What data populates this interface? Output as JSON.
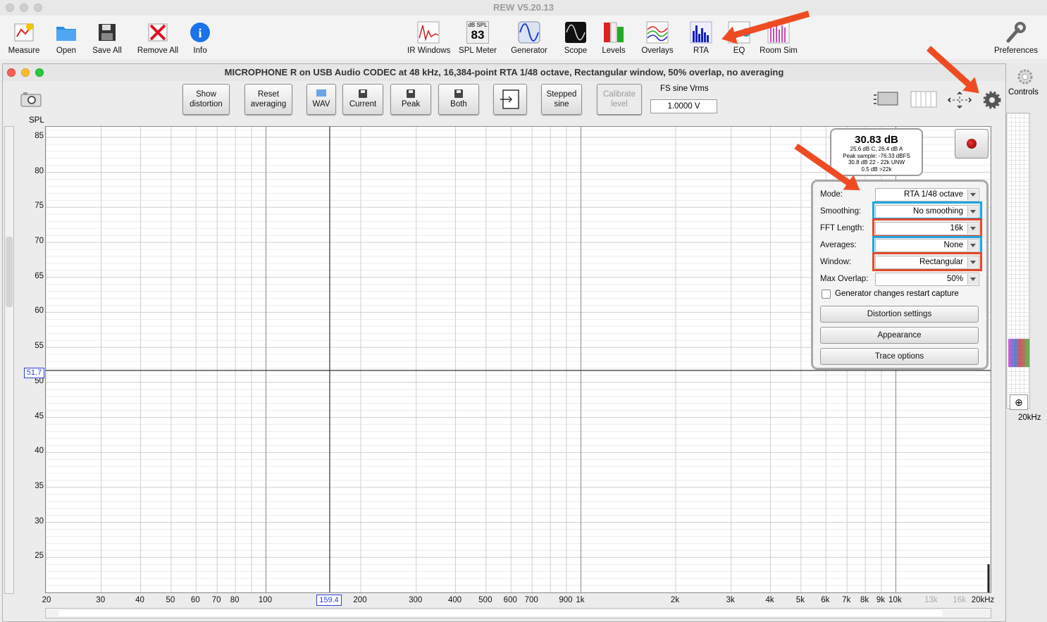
{
  "app": {
    "title": "REW V5.20.13"
  },
  "toolbar": {
    "left": [
      {
        "name": "measure",
        "label": "Measure",
        "icon": "measure-icon"
      },
      {
        "name": "open",
        "label": "Open",
        "icon": "folder-icon"
      },
      {
        "name": "save-all",
        "label": "Save All",
        "icon": "save-icon"
      },
      {
        "name": "remove-all",
        "label": "Remove All",
        "icon": "remove-icon"
      },
      {
        "name": "info",
        "label": "Info",
        "icon": "info-icon"
      }
    ],
    "center": [
      {
        "name": "ir-windows",
        "label": "IR Windows",
        "icon": "ir-icon"
      },
      {
        "name": "spl-meter",
        "label": "SPL Meter",
        "icon": "spl-icon",
        "badge_top": "dB SPL",
        "badge_value": "83"
      },
      {
        "name": "generator",
        "label": "Generator",
        "icon": "sine-icon"
      },
      {
        "name": "scope",
        "label": "Scope",
        "icon": "scope-icon"
      },
      {
        "name": "levels",
        "label": "Levels",
        "icon": "levels-icon"
      },
      {
        "name": "overlays",
        "label": "Overlays",
        "icon": "overlays-icon"
      },
      {
        "name": "rta",
        "label": "RTA",
        "icon": "rta-icon"
      },
      {
        "name": "eq",
        "label": "EQ",
        "icon": "eq-icon"
      },
      {
        "name": "room-sim",
        "label": "Room Sim",
        "icon": "room-icon"
      }
    ],
    "preferences_label": "Preferences"
  },
  "rta": {
    "title": "MICROPHONE R on USB Audio CODEC  at 48 kHz, 16,384-point RTA 1/48 octave, Rectangular window, 50% overlap, no averaging",
    "buttons": {
      "show_distortion": "Show distortion",
      "reset_averaging": "Reset averaging",
      "wav": "WAV",
      "current": "Current",
      "peak": "Peak",
      "both": "Both",
      "stepped_sine": "Stepped sine",
      "calibrate_level": "Calibrate level"
    },
    "fs_sine_label": "FS sine Vrms",
    "fs_sine_value": "1.0000 V",
    "y_axis_label": "SPL",
    "y_ticks": [
      "85",
      "80",
      "75",
      "70",
      "65",
      "60",
      "55",
      "50",
      "45",
      "40",
      "35",
      "30",
      "25"
    ],
    "cursor_y_value": "51.7",
    "cursor_x_value": "159.4",
    "x_ticks": [
      "20",
      "30",
      "40",
      "50",
      "60",
      "70",
      "80",
      "100",
      "200",
      "300",
      "400",
      "500",
      "600",
      "700",
      "900",
      "1k",
      "2k",
      "3k",
      "4k",
      "5k",
      "6k",
      "7k",
      "8k",
      "9k",
      "10k",
      "13k",
      "16k",
      "20kHz"
    ],
    "readout": {
      "main": "30.83 dB",
      "line1": "25.6 dB C, 26.4 dB A",
      "line2": "Peak sample: -76.33 dBFS",
      "line3": "30.8 dB 22 - 22k UNW",
      "line4": "0.5 dB >22k"
    },
    "controls": {
      "mode_label": "Mode:",
      "mode_value": "RTA 1/48 octave",
      "smoothing_label": "Smoothing:",
      "smoothing_value": "No  smoothing",
      "fft_label": "FFT Length:",
      "fft_value": "16k",
      "averages_label": "Averages:",
      "averages_value": "None",
      "window_label": "Window:",
      "window_value": "Rectangular",
      "overlap_label": "Max Overlap:",
      "overlap_value": "50%",
      "generator_restart_label": "Generator changes restart capture",
      "distortion_settings": "Distortion settings",
      "appearance": "Appearance",
      "trace_options": "Trace options"
    }
  },
  "side": {
    "controls_label": "Controls",
    "freq_label": "20kHz"
  },
  "colors": {
    "arrow": "#ef4b23",
    "highlight_blue": "#1ea6e0",
    "highlight_red": "#e24a2b"
  }
}
